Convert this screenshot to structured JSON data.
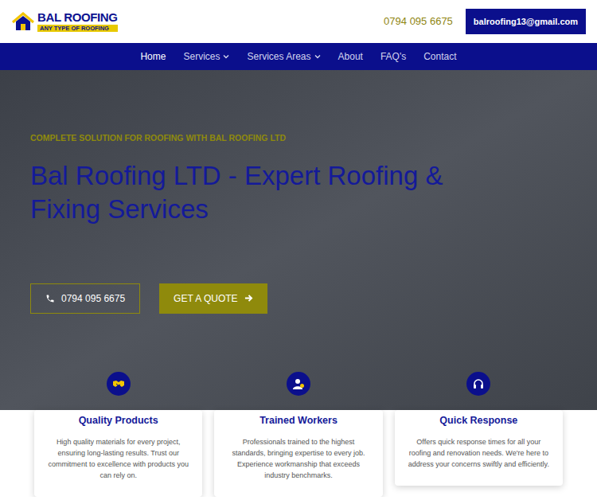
{
  "logo": {
    "name": "BAL ROOFING",
    "tagline": "ANY TYPE OF ROOFING"
  },
  "header": {
    "phone": "0794 095 6675",
    "email": "balroofing13@gmail.com"
  },
  "nav": [
    {
      "label": "Home",
      "selected": true,
      "kind": "link"
    },
    {
      "label": "Services",
      "selected": false,
      "kind": "dropdown"
    },
    {
      "label": "Services Areas",
      "selected": false,
      "kind": "dropdown"
    },
    {
      "label": "About",
      "selected": false,
      "kind": "link"
    },
    {
      "label": "FAQ's",
      "selected": false,
      "kind": "link"
    },
    {
      "label": "Contact",
      "selected": false,
      "kind": "link"
    }
  ],
  "hero": {
    "eyebrow": "COMPLETE SOLUTION FOR ROOFING WITH BAL ROOFING LTD",
    "title": "Bal Roofing LTD - Expert Roofing & Fixing Services",
    "phone_button": "0794 095 6675",
    "quote_button": "GET A QUOTE"
  },
  "features": [
    {
      "title": "Quality Products",
      "text": "High quality materials for every project, ensuring long-lasting results. Trust our commitment to excellence with products you can rely on.",
      "kind": "handshake"
    },
    {
      "title": "Trained Workers",
      "text": "Professionals trained to the highest standards, bringing expertise to every job. Experience workmanship that exceeds industry benchmarks.",
      "kind": "worker"
    },
    {
      "title": "Quick Response",
      "text": "Offers quick response times for all your roofing and renovation needs. We're here to address your concerns swiftly and efficiently.",
      "kind": "headset"
    }
  ]
}
